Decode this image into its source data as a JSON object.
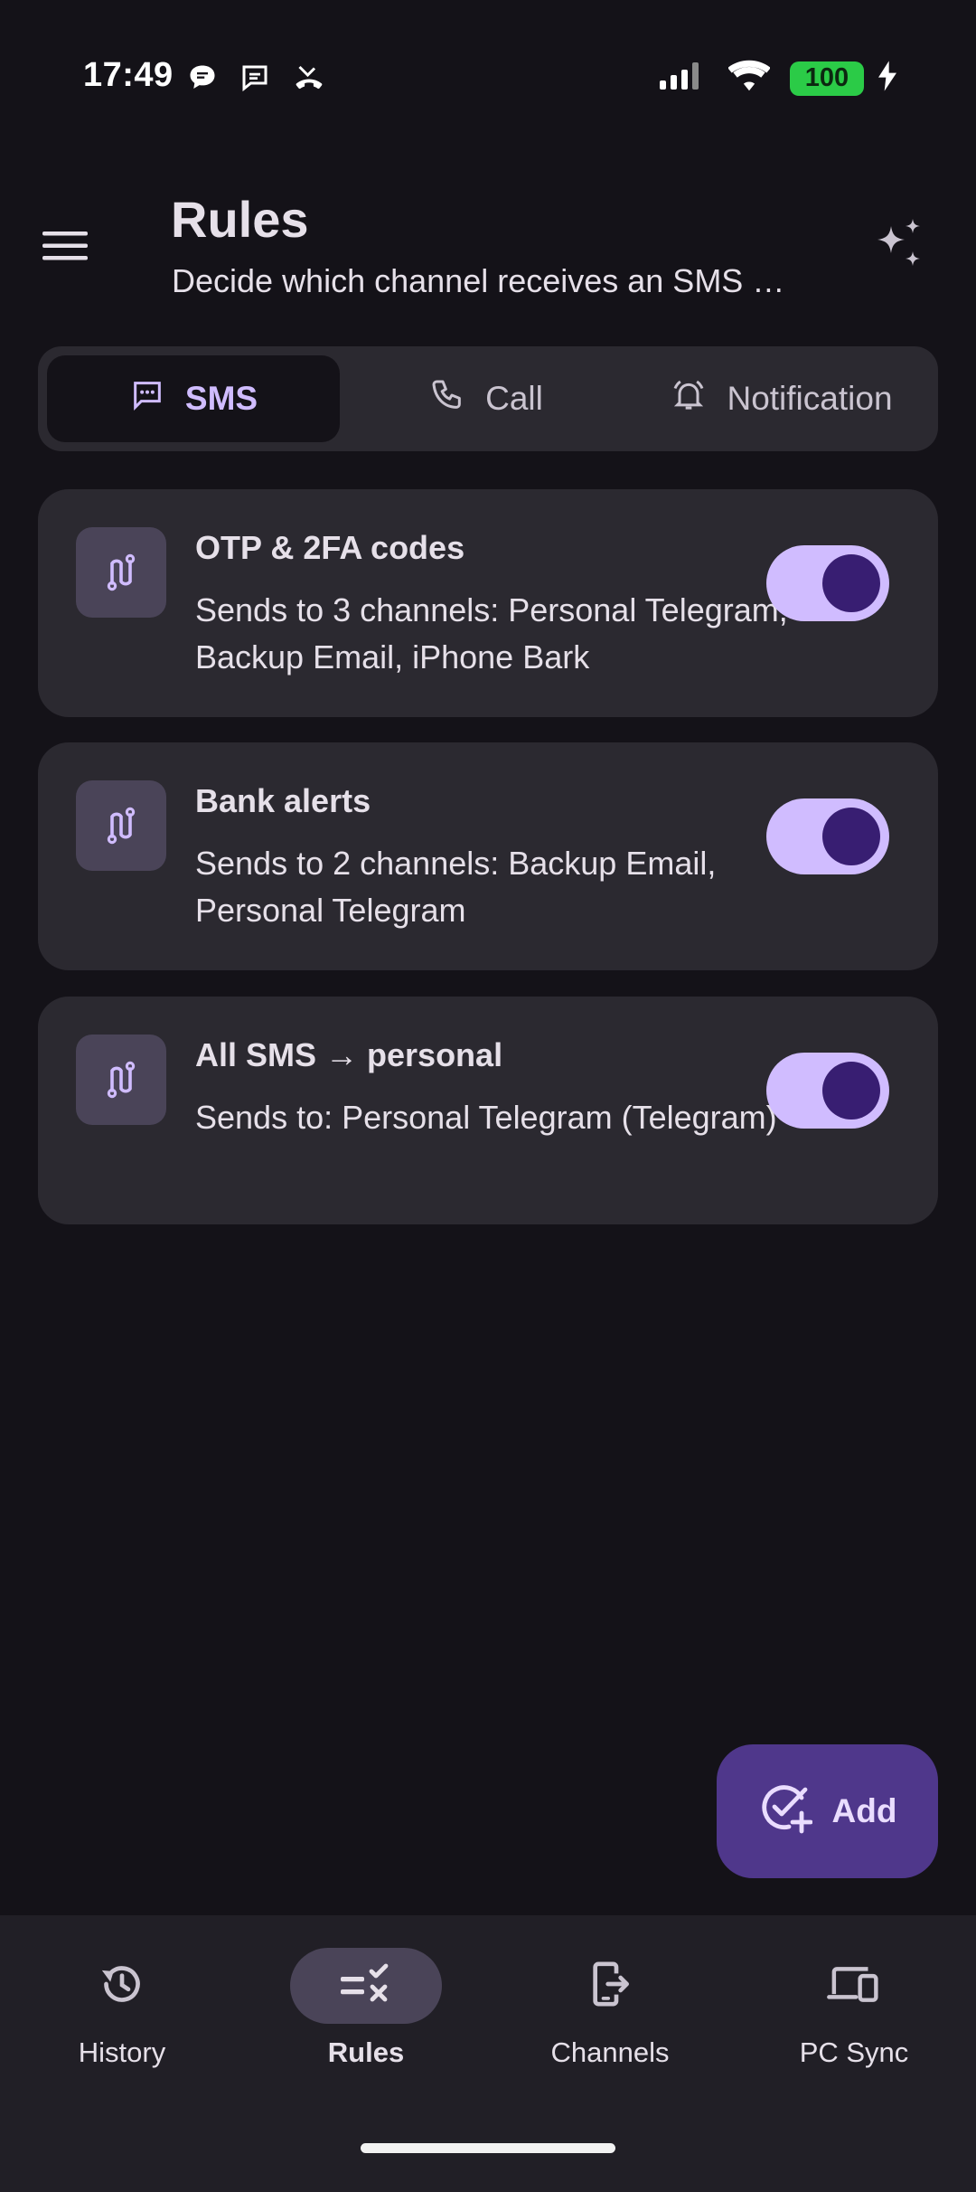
{
  "status_bar": {
    "time": "17:49",
    "battery": "100",
    "icons": [
      "chat-bubble-icon",
      "sms-notification-icon",
      "missed-call-icon",
      "signal-icon",
      "wifi-icon",
      "battery-icon",
      "charging-bolt-icon"
    ]
  },
  "header": {
    "title": "Rules",
    "subtitle": "Decide which channel receives an SMS …",
    "menu_icon": "hamburger-menu-icon",
    "action_icon": "sparkle-icon"
  },
  "tabs": [
    {
      "label": "SMS",
      "icon": "sms-icon",
      "active": true
    },
    {
      "label": "Call",
      "icon": "phone-icon",
      "active": false
    },
    {
      "label": "Notification",
      "icon": "bell-icon",
      "active": false
    }
  ],
  "rules": [
    {
      "title": "OTP & 2FA codes",
      "description": "Sends to 3 channels: Personal Telegram, Backup Email, iPhone Bark",
      "enabled": true
    },
    {
      "title": "Bank alerts",
      "description": "Sends to 2 channels: Backup Email, Personal Telegram",
      "enabled": true
    },
    {
      "title": "All SMS → personal",
      "description": "Sends to: Personal Telegram (Telegram)",
      "enabled": true
    }
  ],
  "fab": {
    "label": "Add",
    "icon": "add-check-icon"
  },
  "bottom_nav": [
    {
      "label": "History",
      "icon": "history-icon",
      "active": false
    },
    {
      "label": "Rules",
      "icon": "rules-icon",
      "active": true
    },
    {
      "label": "Channels",
      "icon": "channel-device-icon",
      "active": false
    },
    {
      "label": "PC Sync",
      "icon": "devices-icon",
      "active": false
    }
  ],
  "colors": {
    "background": "#141218",
    "surface": "#2B2930",
    "accent": "#D0BCFF",
    "fab": "#4F378B",
    "battery": "#2BCB47"
  }
}
